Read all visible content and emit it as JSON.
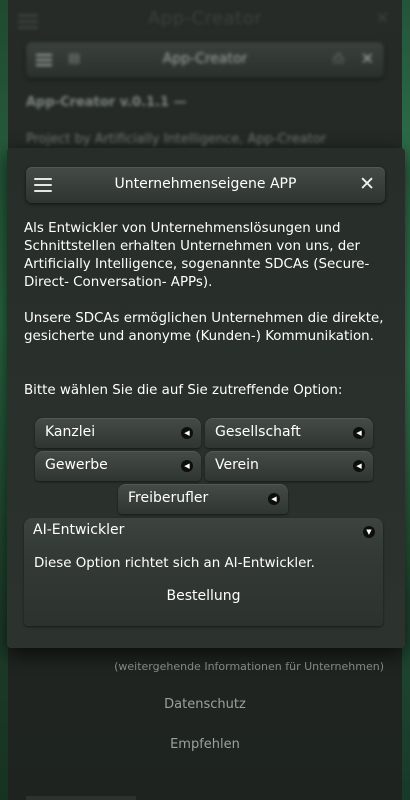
{
  "background": {
    "top_title": "App-Creator",
    "header_title": "App-Creator",
    "version": "App-Creator v.0.1.1 —",
    "project": "Project by Artificially Intelligence, App-Creator",
    "more_info": "(weitergehende Informationen für Unternehmen)",
    "privacy": "Datenschutz",
    "recommend": "Empfehlen"
  },
  "dialog": {
    "title": "Unternehmenseigene APP",
    "intro": "Als Entwickler von Unternehmenslösungen und Schnittstellen erhalten Unternehmen von uns, der Artificially Intelligence, sogenannte SDCAs (Secure-Direct- Conversation- APPs).",
    "description": "Unsere SDCAs ermöglichen Unternehmen die direkte, gesicherte und anonyme (Kunden-) Kommunikation.",
    "prompt": "Bitte wählen Sie die auf Sie zutreffende Option:",
    "options": [
      "Kanzlei",
      "Gesellschaft",
      "Gewerbe",
      "Verein",
      "Freiberufler"
    ],
    "expanded_option": {
      "label": "AI-Entwickler",
      "description": "Diese Option richtet sich an AI-Entwickler.",
      "action": "Bestellung"
    }
  },
  "icons": {
    "menu": "menu-icon",
    "close": "close-icon",
    "collapsed_arrow": "◀",
    "expanded_arrow": "▼"
  },
  "colors": {
    "dialog_bg": "#2a302c",
    "button_top": "#454b47",
    "button_bottom": "#2f3531",
    "arrow_circle": "#0d0f0e",
    "edge_green": "#3a8a5a"
  }
}
